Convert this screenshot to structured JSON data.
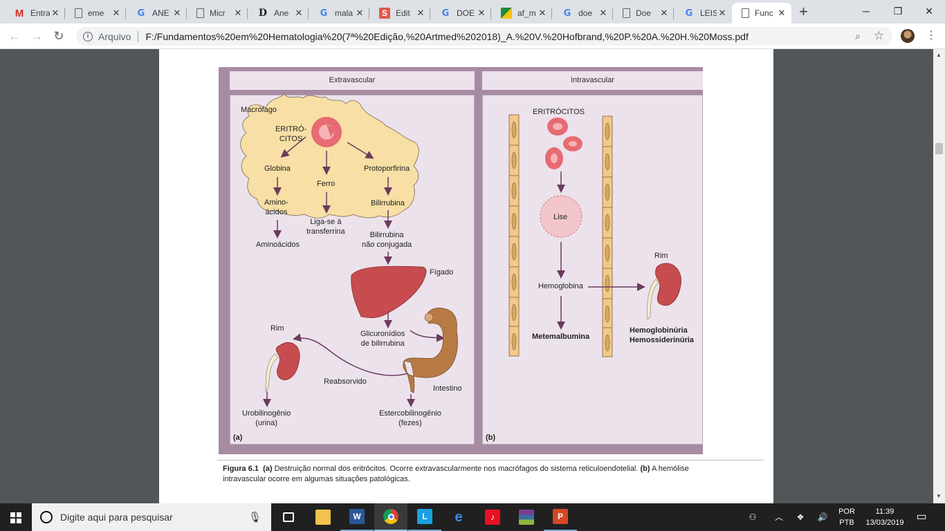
{
  "browser": {
    "tabs": [
      {
        "title": "Entra",
        "icon": "gmail-icon"
      },
      {
        "title": "eme",
        "icon": "document-icon"
      },
      {
        "title": "ANE",
        "icon": "google-icon"
      },
      {
        "title": "Micr",
        "icon": "document-icon"
      },
      {
        "title": "Ane",
        "icon": "d-logo-icon"
      },
      {
        "title": "mala",
        "icon": "google-icon"
      },
      {
        "title": "Edit",
        "icon": "s-logo-icon"
      },
      {
        "title": "DOE",
        "icon": "google-icon"
      },
      {
        "title": "af_m",
        "icon": "flag-icon"
      },
      {
        "title": "doe",
        "icon": "google-icon"
      },
      {
        "title": "Doe",
        "icon": "document-icon"
      },
      {
        "title": "LEIS",
        "icon": "google-icon"
      },
      {
        "title": "Func",
        "icon": "document-icon",
        "active": true
      }
    ],
    "address": {
      "scheme_label": "Arquivo",
      "url": "F:/Fundamentos%20em%20Hematologia%20(7ª%20Edição,%20Artmed%202018)_A.%20V.%20Hofbrand,%20P.%20A.%20H.%20Moss.pdf"
    }
  },
  "figure": {
    "panel_a": {
      "header": "Extravascular",
      "macrophage": "Macrófago",
      "erythrocytes": "ERITRÓ-\nCITOS",
      "globin": "Globina",
      "iron": "Ferro",
      "protoporphyrin": "Protoporfirina",
      "amino_acids_inner": "Amino-\nácidos",
      "binds_transferrin": "Liga-se à\ntransferrina",
      "bilirubin": "Bilirrubina",
      "amino_acids": "Aminoácidos",
      "unconjugated": "Bilirrubina\nnão conjugada",
      "liver": "Fígado",
      "kidney": "Rim",
      "glucuronides": "Glicuronídios\nde bilirrubina",
      "reabsorbed": "Reabsorvido",
      "intestine": "Intestino",
      "urobilinogen": "Urobilinogênio\n(urina)",
      "stercobilinogen": "Estercobilinogênio\n(fezes)",
      "tag": "(a)"
    },
    "panel_b": {
      "header": "Intravascular",
      "erythrocytes": "ERITRÓCITOS",
      "lysis": "Lise",
      "hemoglobin": "Hemoglobina",
      "kidney": "Rim",
      "methemalbumin": "Metemalbumina",
      "hemoglobinuria": "Hemoglobinúria",
      "hemosiderinuria": "Hemossiderinúria",
      "tag": "(b)"
    },
    "caption": {
      "label": "Figura 6.1",
      "a_tag": "(a)",
      "a_text": " Destruição normal dos eritrócitos. Ocorre extravascularmente nos macrófagos do sistema reticuloendotelial. ",
      "b_tag": "(b)",
      "b_text": " A hemólise intravascular ocorre em algumas situações patológicas."
    }
  },
  "taskbar": {
    "search_placeholder": "Digite aqui para pesquisar",
    "lang_top": "POR",
    "lang_bottom": "PTB",
    "time": "11:39",
    "date": "13/03/2019",
    "apps": [
      "task-view-icon",
      "file-explorer-icon",
      "word-icon",
      "chrome-icon",
      "l-app-icon",
      "edge-icon",
      "music-app-icon",
      "winrar-icon",
      "powerpoint-icon"
    ]
  },
  "colors": {
    "accent_figure_frame": "#a68ca3",
    "panel_bg": "#ece2ec",
    "macrophage": "#f7dfa5",
    "erythrocyte": "#e76b73",
    "liver": "#c64c4f",
    "intestine": "#b77a45",
    "vessel": "#f3c988",
    "arrow": "#6b3a5e"
  }
}
